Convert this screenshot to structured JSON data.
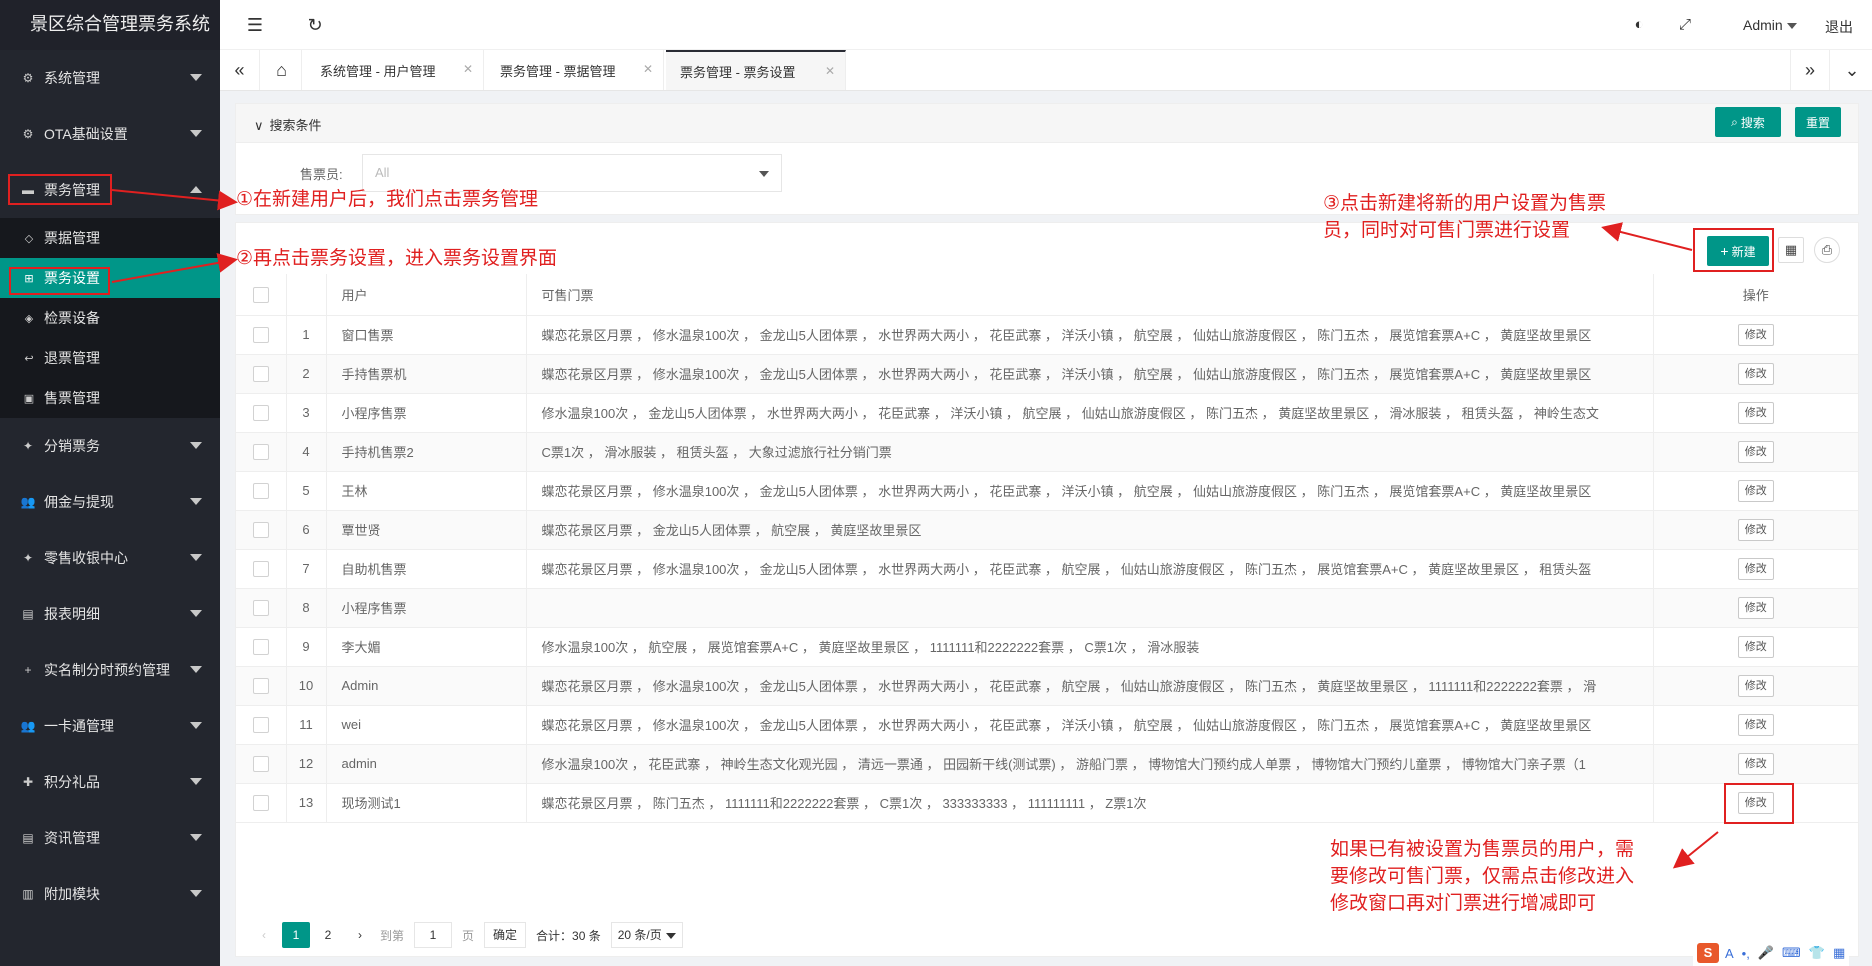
{
  "app": {
    "title": "景区综合管理票务系统"
  },
  "sidebar": {
    "top_items": [
      {
        "label": "系统管理"
      },
      {
        "label": "OTA基础设置"
      },
      {
        "label": "票务管理"
      }
    ],
    "ticket_sub": [
      {
        "label": "票据管理"
      },
      {
        "label": "票务设置"
      },
      {
        "label": "检票设备"
      },
      {
        "label": "退票管理"
      },
      {
        "label": "售票管理"
      }
    ],
    "bottom_items": [
      {
        "label": "分销票务"
      },
      {
        "label": "佣金与提现"
      },
      {
        "label": "零售收银中心"
      },
      {
        "label": "报表明细"
      },
      {
        "label": "实名制分时预约管理"
      },
      {
        "label": "一卡通管理"
      },
      {
        "label": "积分礼品"
      },
      {
        "label": "资讯管理"
      },
      {
        "label": "附加模块"
      }
    ]
  },
  "topbar": {
    "user": "Admin",
    "logout": "退出"
  },
  "tabs": [
    {
      "label": "系统管理 - 用户管理"
    },
    {
      "label": "票务管理 - 票据管理"
    },
    {
      "label": "票务管理 - 票务设置"
    }
  ],
  "search": {
    "title": "搜索条件",
    "search_btn": "搜索",
    "reset_btn": "重置",
    "field_label": "售票员:",
    "field_value": "All"
  },
  "toolbar": {
    "new_btn": "新建"
  },
  "table": {
    "headers": {
      "user": "用户",
      "tickets": "可售门票",
      "ops": "操作"
    },
    "edit_label": "修改",
    "rows": [
      {
        "no": "1",
        "user": "窗口售票",
        "tickets": "蝶恋花景区月票 ， 修水温泉100次 ， 金龙山5人团体票 ， 水世界两大两小 ， 花臣武寨 ， 洋沃小镇 ， 航空展 ， 仙姑山旅游度假区 ， 陈门五杰 ， 展览馆套票A+C ， 黄庭坚故里景区"
      },
      {
        "no": "2",
        "user": "手持售票机",
        "tickets": "蝶恋花景区月票 ， 修水温泉100次 ， 金龙山5人团体票 ， 水世界两大两小 ， 花臣武寨 ， 洋沃小镇 ， 航空展 ， 仙姑山旅游度假区 ， 陈门五杰 ， 展览馆套票A+C ， 黄庭坚故里景区"
      },
      {
        "no": "3",
        "user": "小程序售票",
        "tickets": "修水温泉100次 ， 金龙山5人团体票 ， 水世界两大两小 ， 花臣武寨 ， 洋沃小镇 ， 航空展 ， 仙姑山旅游度假区 ， 陈门五杰 ， 黄庭坚故里景区 ， 滑冰服装 ， 租赁头盔 ， 神岭生态文"
      },
      {
        "no": "4",
        "user": "手持机售票2",
        "tickets": "C票1次 ， 滑冰服装 ， 租赁头盔 ， 大象过滤旅行社分销门票"
      },
      {
        "no": "5",
        "user": "王林",
        "tickets": "蝶恋花景区月票 ， 修水温泉100次 ， 金龙山5人团体票 ， 水世界两大两小 ， 花臣武寨 ， 洋沃小镇 ， 航空展 ， 仙姑山旅游度假区 ， 陈门五杰 ， 展览馆套票A+C ， 黄庭坚故里景区"
      },
      {
        "no": "6",
        "user": "覃世贤",
        "tickets": "蝶恋花景区月票 ， 金龙山5人团体票 ， 航空展 ， 黄庭坚故里景区"
      },
      {
        "no": "7",
        "user": "自助机售票",
        "tickets": "蝶恋花景区月票 ， 修水温泉100次 ， 金龙山5人团体票 ， 水世界两大两小 ， 花臣武寨 ， 航空展 ， 仙姑山旅游度假区 ， 陈门五杰 ， 展览馆套票A+C ， 黄庭坚故里景区 ， 租赁头盔"
      },
      {
        "no": "8",
        "user": "小程序售票",
        "tickets": ""
      },
      {
        "no": "9",
        "user": "李大媚",
        "tickets": "修水温泉100次 ， 航空展 ， 展览馆套票A+C ， 黄庭坚故里景区 ， 1111111和2222222套票 ， C票1次 ， 滑冰服装"
      },
      {
        "no": "10",
        "user": "Admin",
        "tickets": "蝶恋花景区月票 ， 修水温泉100次 ， 金龙山5人团体票 ， 水世界两大两小 ， 花臣武寨 ， 航空展 ， 仙姑山旅游度假区 ， 陈门五杰 ， 黄庭坚故里景区 ， 1111111和2222222套票 ， 滑"
      },
      {
        "no": "11",
        "user": "wei",
        "tickets": "蝶恋花景区月票 ， 修水温泉100次 ， 金龙山5人团体票 ， 水世界两大两小 ， 花臣武寨 ， 洋沃小镇 ， 航空展 ， 仙姑山旅游度假区 ， 陈门五杰 ， 展览馆套票A+C ， 黄庭坚故里景区"
      },
      {
        "no": "12",
        "user": "admin",
        "tickets": "修水温泉100次 ， 花臣武寨 ， 神岭生态文化观光园 ， 清远一票通 ， 田园新干线(测试票) ， 游船门票 ， 博物馆大门预约成人单票 ， 博物馆大门预约儿童票 ， 博物馆大门亲子票（1"
      },
      {
        "no": "13",
        "user": "现场测试1",
        "tickets": "蝶恋花景区月票 ， 陈门五杰 ， 1111111和2222222套票 ， C票1次 ， 333333333 ， 111111111 ， Z票1次"
      }
    ]
  },
  "pager": {
    "pages": [
      "1",
      "2"
    ],
    "goto": "到第",
    "goto_value": "1",
    "page_unit": "页",
    "confirm": "确定",
    "total": "合计：30 条",
    "per_page": "20 条/页"
  },
  "annotations": {
    "a1": "①在新建用户后，我们点击票务管理",
    "a2": "②再点击票务设置，进入票务设置界面",
    "a3_line1": "③点击新建将新的用户设置为售票",
    "a3_line2": "员，同时对可售门票进行设置",
    "a4_line1": "如果已有被设置为售票员的用户，需",
    "a4_line2": "要修改可售门票，仅需点击修改进入",
    "a4_line3": "修改窗口再对门票进行增减即可"
  },
  "colors": {
    "accent": "#009688",
    "sidebar": "#23262e",
    "annotation": "#e02020"
  }
}
